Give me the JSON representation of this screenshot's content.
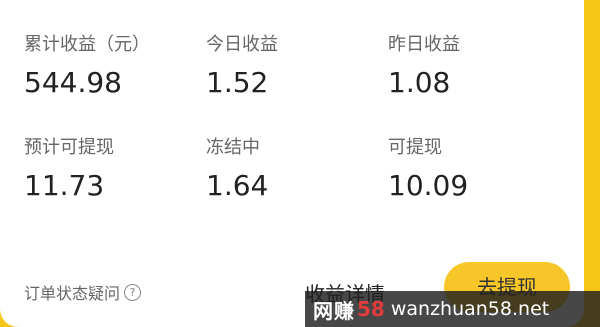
{
  "stats": [
    {
      "label": "累计收益（元）",
      "value": "544.98"
    },
    {
      "label": "今日收益",
      "value": "1.52"
    },
    {
      "label": "昨日收益",
      "value": "1.08"
    },
    {
      "label": "预计可提现",
      "value": "11.73"
    },
    {
      "label": "冻结中",
      "value": "1.64"
    },
    {
      "label": "可提现",
      "value": "10.09"
    }
  ],
  "footer": {
    "faq_label": "订单状态疑问",
    "faq_icon_text": "?",
    "detail_label": "收益详情",
    "withdraw_label": "去提现"
  },
  "watermark": {
    "brand": "网赚",
    "logo": "58",
    "url": "wanzhuan58.net"
  },
  "colors": {
    "accent": "#f5c518",
    "button": "#f7c72a"
  }
}
